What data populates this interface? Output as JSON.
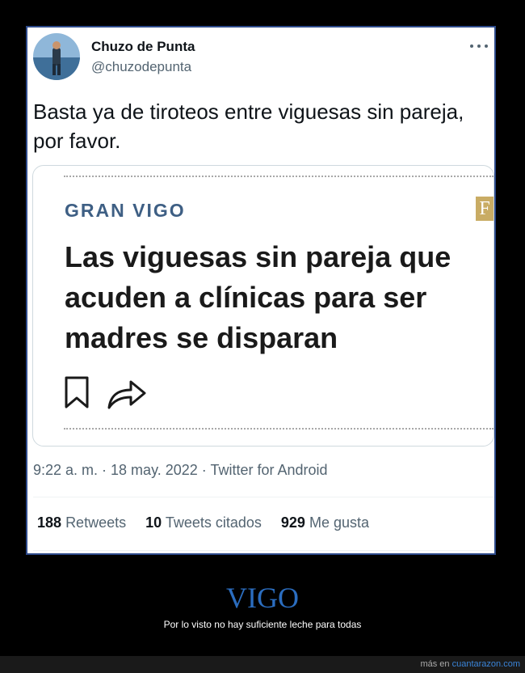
{
  "tweet": {
    "author_name": "Chuzo de Punta",
    "author_handle": "@chuzodepunta",
    "text": "Basta ya de tiroteos entre viguesas sin pareja, por favor.",
    "timestamp": "9:22 a. m. · 18 may. 2022 · Twitter for Android",
    "stats": [
      {
        "count": "188",
        "label": "Retweets"
      },
      {
        "count": "10",
        "label": "Tweets citados"
      },
      {
        "count": "929",
        "label": "Me gusta"
      }
    ]
  },
  "card": {
    "section": "GRAN VIGO",
    "logo_letter": "F",
    "headline": "Las viguesas sin pareja que acuden a clínicas para ser madres se disparan",
    "icons": [
      "bookmark-icon",
      "share-icon"
    ]
  },
  "caption": {
    "title": "VIGO",
    "subtitle": "Por lo visto no hay suficiente leche para todas"
  },
  "footer": {
    "prefix": "más en",
    "site": "cuantarazon.com"
  },
  "colors": {
    "frame_border": "#2d4a8a",
    "caption_title": "#2b6dbf",
    "section_label": "#3e5f84",
    "logo_bg": "#c9ac64"
  }
}
